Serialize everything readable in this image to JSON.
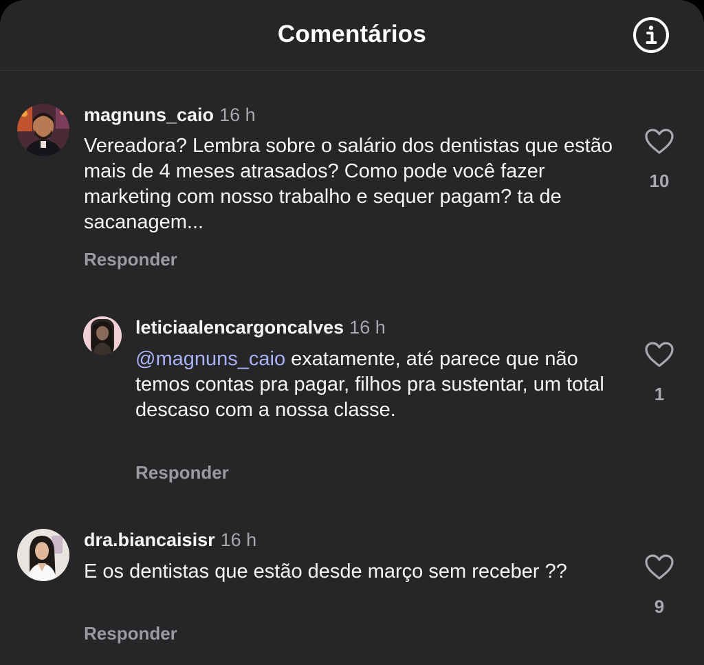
{
  "header": {
    "title": "Comentários",
    "info_icon": "info-circle-icon"
  },
  "comments": [
    {
      "username": "magnuns_caio",
      "time": "16 h",
      "text": "Vereadora? Lembra sobre o salário dos dentistas que estão mais de 4 meses atrasados? Como pode você fazer marketing com nosso trabalho e sequer pagam? ta de sacanagem...",
      "reply_label": "Responder",
      "likes": "10",
      "like_icon": "heart-outline-icon"
    },
    {
      "username": "leticiaalencargoncalves",
      "time": "16 h",
      "mention": "@magnuns_caio",
      "text": "exatamente, até parece que não temos contas pra pagar, filhos pra sustentar, um total descaso com a nossa classe.",
      "reply_label": "Responder",
      "likes": "1",
      "like_icon": "heart-outline-icon"
    },
    {
      "username": "dra.biancaisisr",
      "time": "16 h",
      "text": "E os dentistas que estão desde março sem receber ??",
      "reply_label": "Responder",
      "likes": "9",
      "like_icon": "heart-outline-icon"
    }
  ]
}
